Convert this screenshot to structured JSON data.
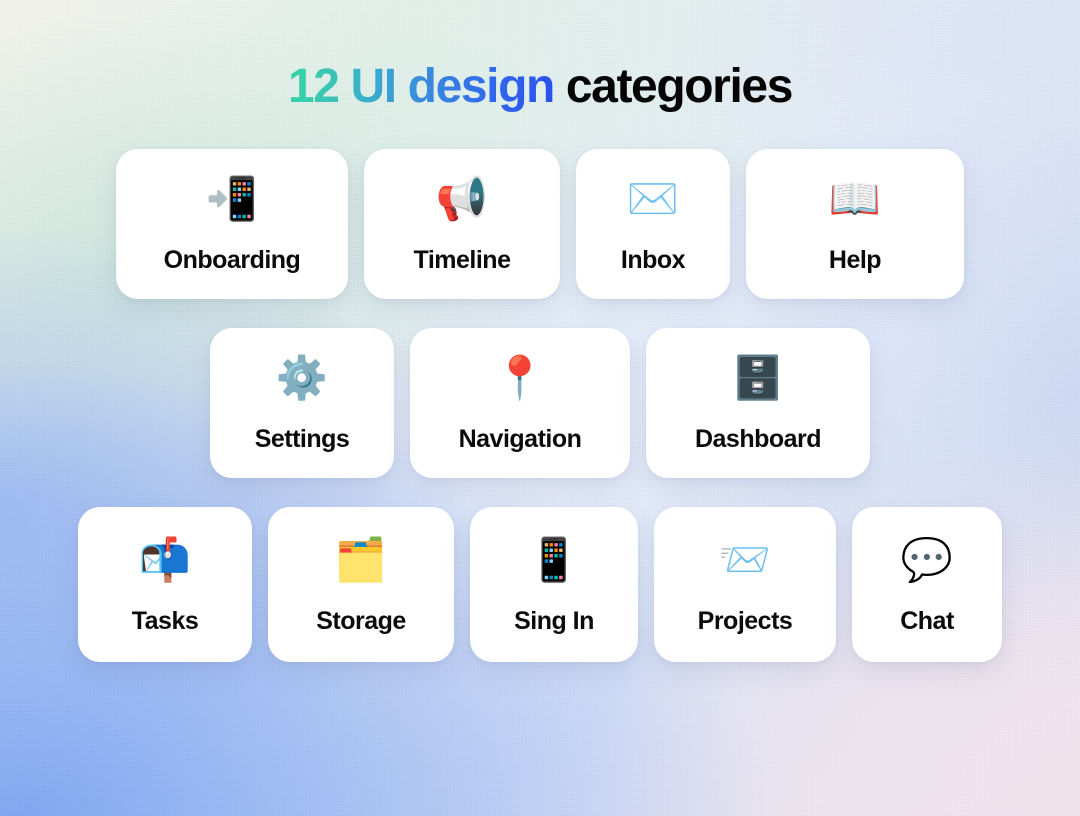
{
  "title": {
    "gradient_part": "12 UI design",
    "plain_part": " categories",
    "full": "12 UI design categories",
    "gradient_start_color": "#35d3a4",
    "gradient_end_color": "#2a51ee",
    "plain_color": "#050505"
  },
  "background": {
    "top_left_color": "#f7f4ee",
    "top_right_color": "#dee6f7",
    "bottom_left_color": "#8ab0f0",
    "bottom_right_color": "#f3e5ee",
    "mid_left_color": "#cee8de"
  },
  "card_style": {
    "background_color": "#ffffff",
    "label_color": "#0b0b0c",
    "corner_radius": "22px"
  },
  "rows": [
    {
      "id": "row-1",
      "cards": [
        {
          "label": "Onboarding",
          "icon": "mobile-phone-with-arrow-icon",
          "glyph": "📲",
          "width_class": "w-232"
        },
        {
          "label": "Timeline",
          "icon": "loudspeaker-icon",
          "glyph": "📢",
          "width_class": "w-196"
        },
        {
          "label": "Inbox",
          "icon": "envelope-icon",
          "glyph": "✉️",
          "width_class": "w-154"
        },
        {
          "label": "Help",
          "icon": "open-book-icon",
          "glyph": "📖",
          "width_class": "w-218"
        }
      ]
    },
    {
      "id": "row-2",
      "cards": [
        {
          "label": "Settings",
          "icon": "gear-icon",
          "glyph": "⚙️",
          "width_class": "w-184"
        },
        {
          "label": "Navigation",
          "icon": "round-pushpin-icon",
          "glyph": "📍",
          "width_class": "w-220"
        },
        {
          "label": "Dashboard",
          "icon": "file-cabinet-icon",
          "glyph": "🗄️",
          "width_class": "w-224"
        }
      ]
    },
    {
      "id": "row-3",
      "cards": [
        {
          "label": "Tasks",
          "icon": "open-mailbox-with-raised-flag-icon",
          "glyph": "📬",
          "width_class": "w-174"
        },
        {
          "label": "Storage",
          "icon": "card-index-dividers-icon",
          "glyph": "🗂️",
          "width_class": "w-186"
        },
        {
          "label": "Sing In",
          "icon": "mobile-phone-icon",
          "glyph": "📱",
          "width_class": "w-168"
        },
        {
          "label": "Projects",
          "icon": "incoming-envelope-icon",
          "glyph": "📨",
          "width_class": "w-182"
        },
        {
          "label": "Chat",
          "icon": "speech-balloon-icon",
          "glyph": "💬",
          "width_class": "w-148"
        }
      ]
    }
  ]
}
